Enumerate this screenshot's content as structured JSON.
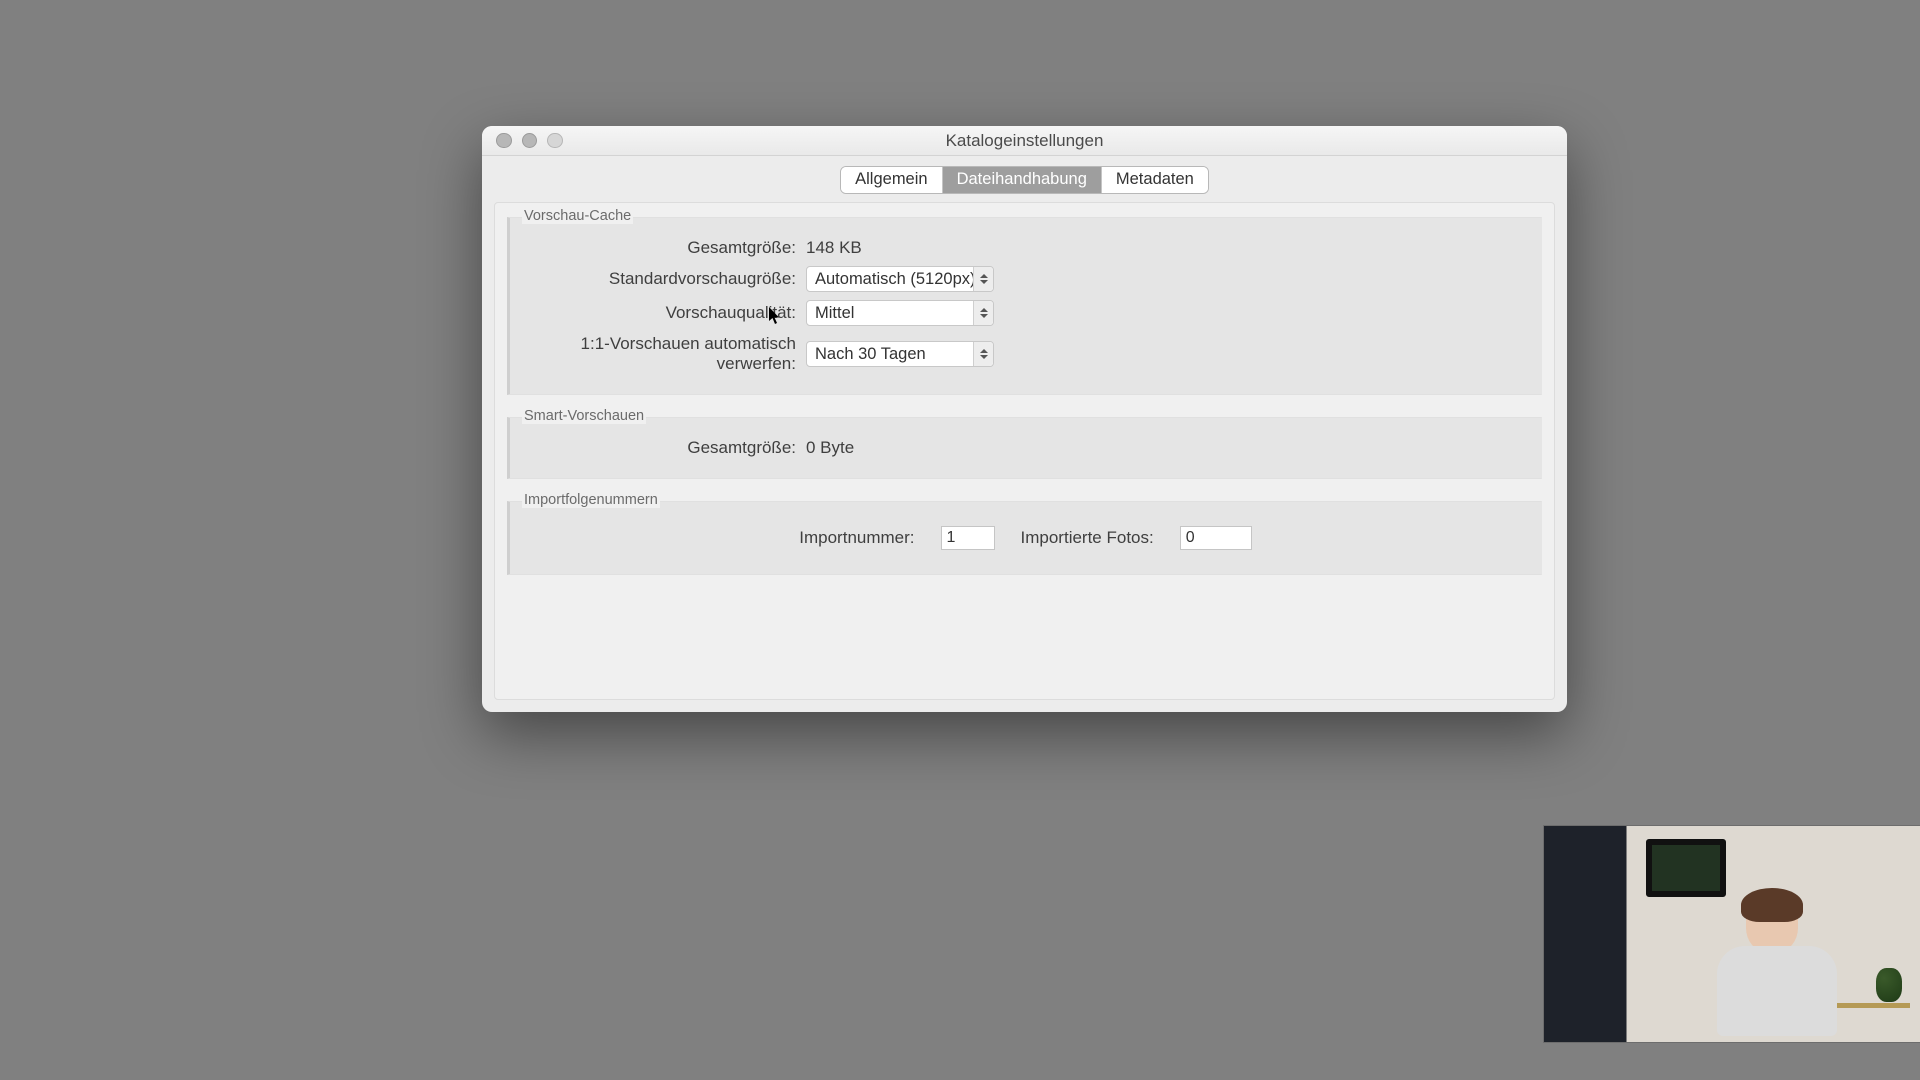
{
  "window": {
    "title": "Katalogeinstellungen"
  },
  "tabs": {
    "items": [
      "Allgemein",
      "Dateihandhabung",
      "Metadaten"
    ],
    "selected": 1
  },
  "groups": {
    "preview_cache": {
      "label": "Vorschau-Cache",
      "total_size_label": "Gesamtgröße:",
      "total_size_value": "148 KB",
      "std_size_label": "Standardvorschaugröße:",
      "std_size_value": "Automatisch (5120px)",
      "quality_label": "Vorschauqualität:",
      "quality_value": "Mittel",
      "discard_label": "1:1-Vorschauen automatisch verwerfen:",
      "discard_value": "Nach 30 Tagen"
    },
    "smart_previews": {
      "label": "Smart-Vorschauen",
      "total_size_label": "Gesamtgröße:",
      "total_size_value": "0 Byte"
    },
    "import_numbers": {
      "label": "Importfolgenummern",
      "import_number_label": "Importnummer:",
      "import_number_value": "1",
      "imported_photos_label": "Importierte Fotos:",
      "imported_photos_value": "0"
    }
  }
}
